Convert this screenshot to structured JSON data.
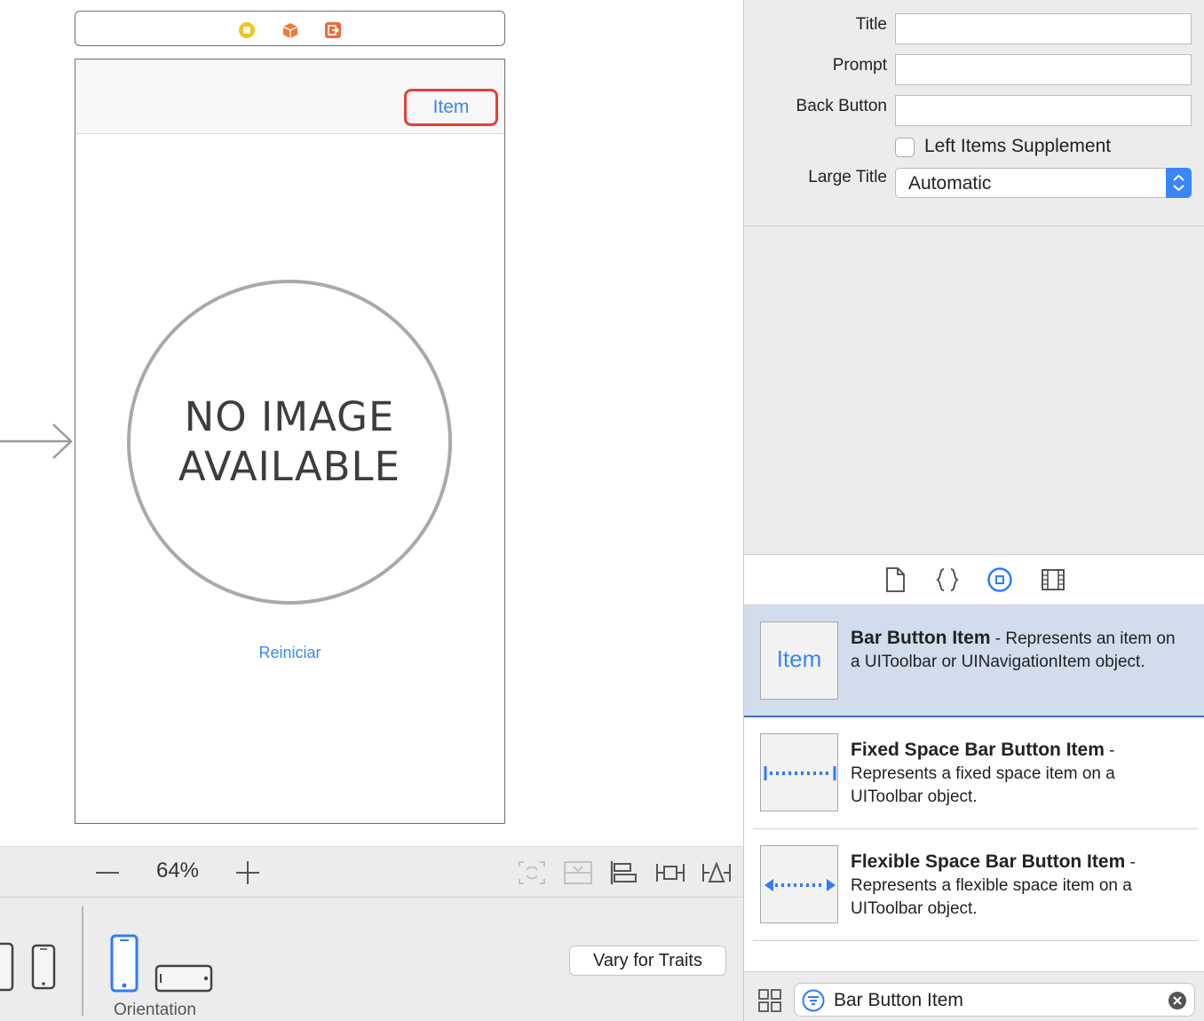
{
  "canvas": {
    "nav_item_label": "Item",
    "placeholder_line1": "NO IMAGE",
    "placeholder_line2": "AVAILABLE",
    "restart_button_label": "Reiniciar"
  },
  "zoom": {
    "level": "64%"
  },
  "device_bar": {
    "orientation_label": "Orientation",
    "vary_for_traits_label": "Vary for Traits"
  },
  "inspector": {
    "fields": {
      "title_label": "Title",
      "title_value": "",
      "prompt_label": "Prompt",
      "prompt_value": "",
      "back_button_label": "Back Button",
      "back_button_value": "",
      "left_items_supplement_label": "Left Items Supplement",
      "left_items_supplement_checked": false,
      "large_title_label": "Large Title",
      "large_title_value": "Automatic"
    }
  },
  "library": {
    "tabs": [
      "file-template-icon",
      "code-snippet-icon",
      "object-library-icon",
      "media-library-icon"
    ],
    "selected_tab": "object-library-icon",
    "items": [
      {
        "thumb_text": "Item",
        "name": "Bar Button Item",
        "description": " - Represents an item on a UIToolbar or UINavigationItem object.",
        "selected": true
      },
      {
        "thumb_text": "",
        "name": "Fixed Space Bar Button Item",
        "description": " - Represents a fixed space item on a UIToolbar object.",
        "selected": false
      },
      {
        "thumb_text": "",
        "name": "Flexible Space Bar Button Item",
        "description": " - Represents a flexible space item on a UIToolbar object.",
        "selected": false
      }
    ],
    "search_value": "Bar Button Item"
  },
  "colors": {
    "accent": "#3b86f6",
    "highlight_border": "#e2413a",
    "selected_row": "#d1dded"
  }
}
